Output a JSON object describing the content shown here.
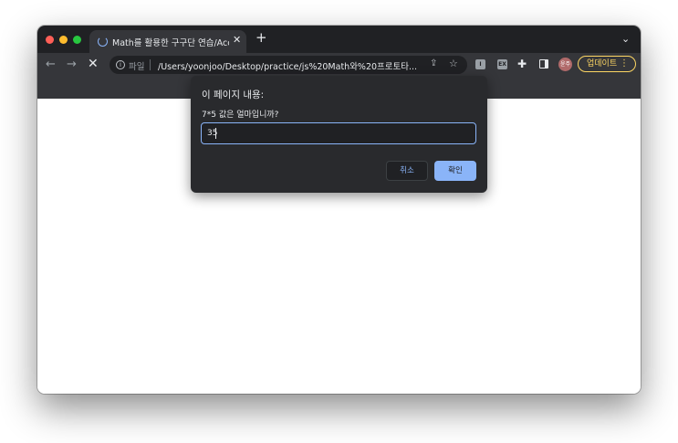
{
  "tab": {
    "title": "Math를 활용한 구구단 연습/Accou",
    "close_icon": "close-icon"
  },
  "toolbar": {
    "scheme_label": "파일",
    "url": "/Users/yoonjoo/Desktop/practice/js%20Math와%20프로토타...",
    "avatar_text": "윤주",
    "update_label": "업데이트",
    "ext1_label": "I",
    "ext2_label": "EX"
  },
  "dialog": {
    "title": "이 페이지 내용:",
    "message": "7*5 값은 얼마입니까?",
    "input_value": "35",
    "cancel_label": "취소",
    "ok_label": "확인"
  },
  "colors": {
    "chrome_dark": "#202124",
    "toolbar": "#35363a",
    "accent": "#8ab4f8",
    "update": "#fdd663"
  }
}
